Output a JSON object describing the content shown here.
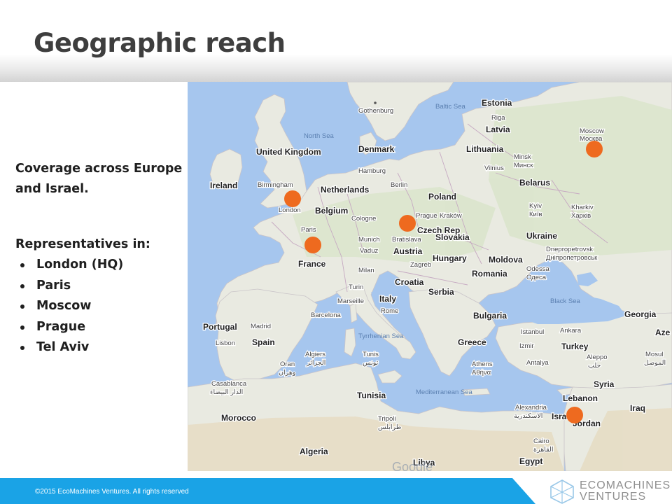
{
  "slide": {
    "title": "Geographic reach",
    "coverage_line1": "Coverage across Europe",
    "coverage_line2": "and Israel.",
    "reps_title": "Representatives in:",
    "representatives": [
      "London (HQ)",
      "Paris",
      "Moscow",
      "Prague",
      "Tel Aviv"
    ]
  },
  "footer": {
    "copyright": "©2015 EcoMachines Ventures. All rights reserved",
    "logo_line1": "ECOMACHINES",
    "logo_line2": "VENTURES"
  },
  "colors": {
    "marker": "#ee6a1f",
    "sea": "#a6c6ee",
    "land": "#e9eae1",
    "footer_blue": "#1aa3e6",
    "title": "#3e3e3e"
  },
  "map": {
    "countries": [
      "United Kingdom",
      "Ireland",
      "Netherlands",
      "Belgium",
      "France",
      "Denmark",
      "Estonia",
      "Latvia",
      "Lithuania",
      "Belarus",
      "Poland",
      "Czech Rep",
      "Slovakia",
      "Austria",
      "Hungary",
      "Ukraine",
      "Moldova",
      "Romania",
      "Croatia",
      "Serbia",
      "Bulgaria",
      "Italy",
      "Portugal",
      "Spain",
      "Greece",
      "Turkey",
      "Georgia",
      "Syria",
      "Lebanon",
      "Israel",
      "Jordan",
      "Iraq",
      "Egypt",
      "Libya",
      "Algeria",
      "Tunisia",
      "Morocco",
      "Aze"
    ],
    "cities": [
      "Gothenburg",
      "Riga",
      "Minsk",
      "Минск",
      "Vilnius",
      "Moscow",
      "Москва",
      "Hamburg",
      "Berlin",
      "Birmingham",
      "London",
      "Paris",
      "Cologne",
      "Prague",
      "Kraków",
      "Kyiv",
      "Київ",
      "Kharkiv",
      "Харків",
      "Bratislava",
      "Munich",
      "Vaduz",
      "Zagreb",
      "Milan",
      "Turin",
      "Dnepropetrovsk",
      "Дніпропетровськ",
      "Odessa",
      "Одеса",
      "Marseille",
      "Rome",
      "Barcelona",
      "Madrid",
      "Lisbon",
      "Istanbul",
      "Ankara",
      "Izmir",
      "Athens",
      "Αθήνα",
      "Algiers",
      "الجزائر",
      "Tunis",
      "تونس",
      "Oran",
      "وهران",
      "Casablanca",
      "الدار البيضاء",
      "Tripoli",
      "طرابلس",
      "Alexandria",
      "الاسكندرية",
      "Cairo",
      "القاهرة",
      "Antalya",
      "Mosul",
      "الموصل",
      "Aleppo",
      "حلب"
    ],
    "seas": [
      "North Sea",
      "Baltic Sea",
      "Black Sea",
      "Tyrrhenian Sea",
      "Mediterranean Sea"
    ],
    "watermark": "Google",
    "offices": [
      {
        "city": "London",
        "label": "London office marker"
      },
      {
        "city": "Paris",
        "label": "Paris office marker"
      },
      {
        "city": "Prague",
        "label": "Prague office marker"
      },
      {
        "city": "Moscow",
        "label": "Moscow office marker"
      },
      {
        "city": "Tel Aviv",
        "label": "Tel Aviv office marker"
      }
    ]
  }
}
